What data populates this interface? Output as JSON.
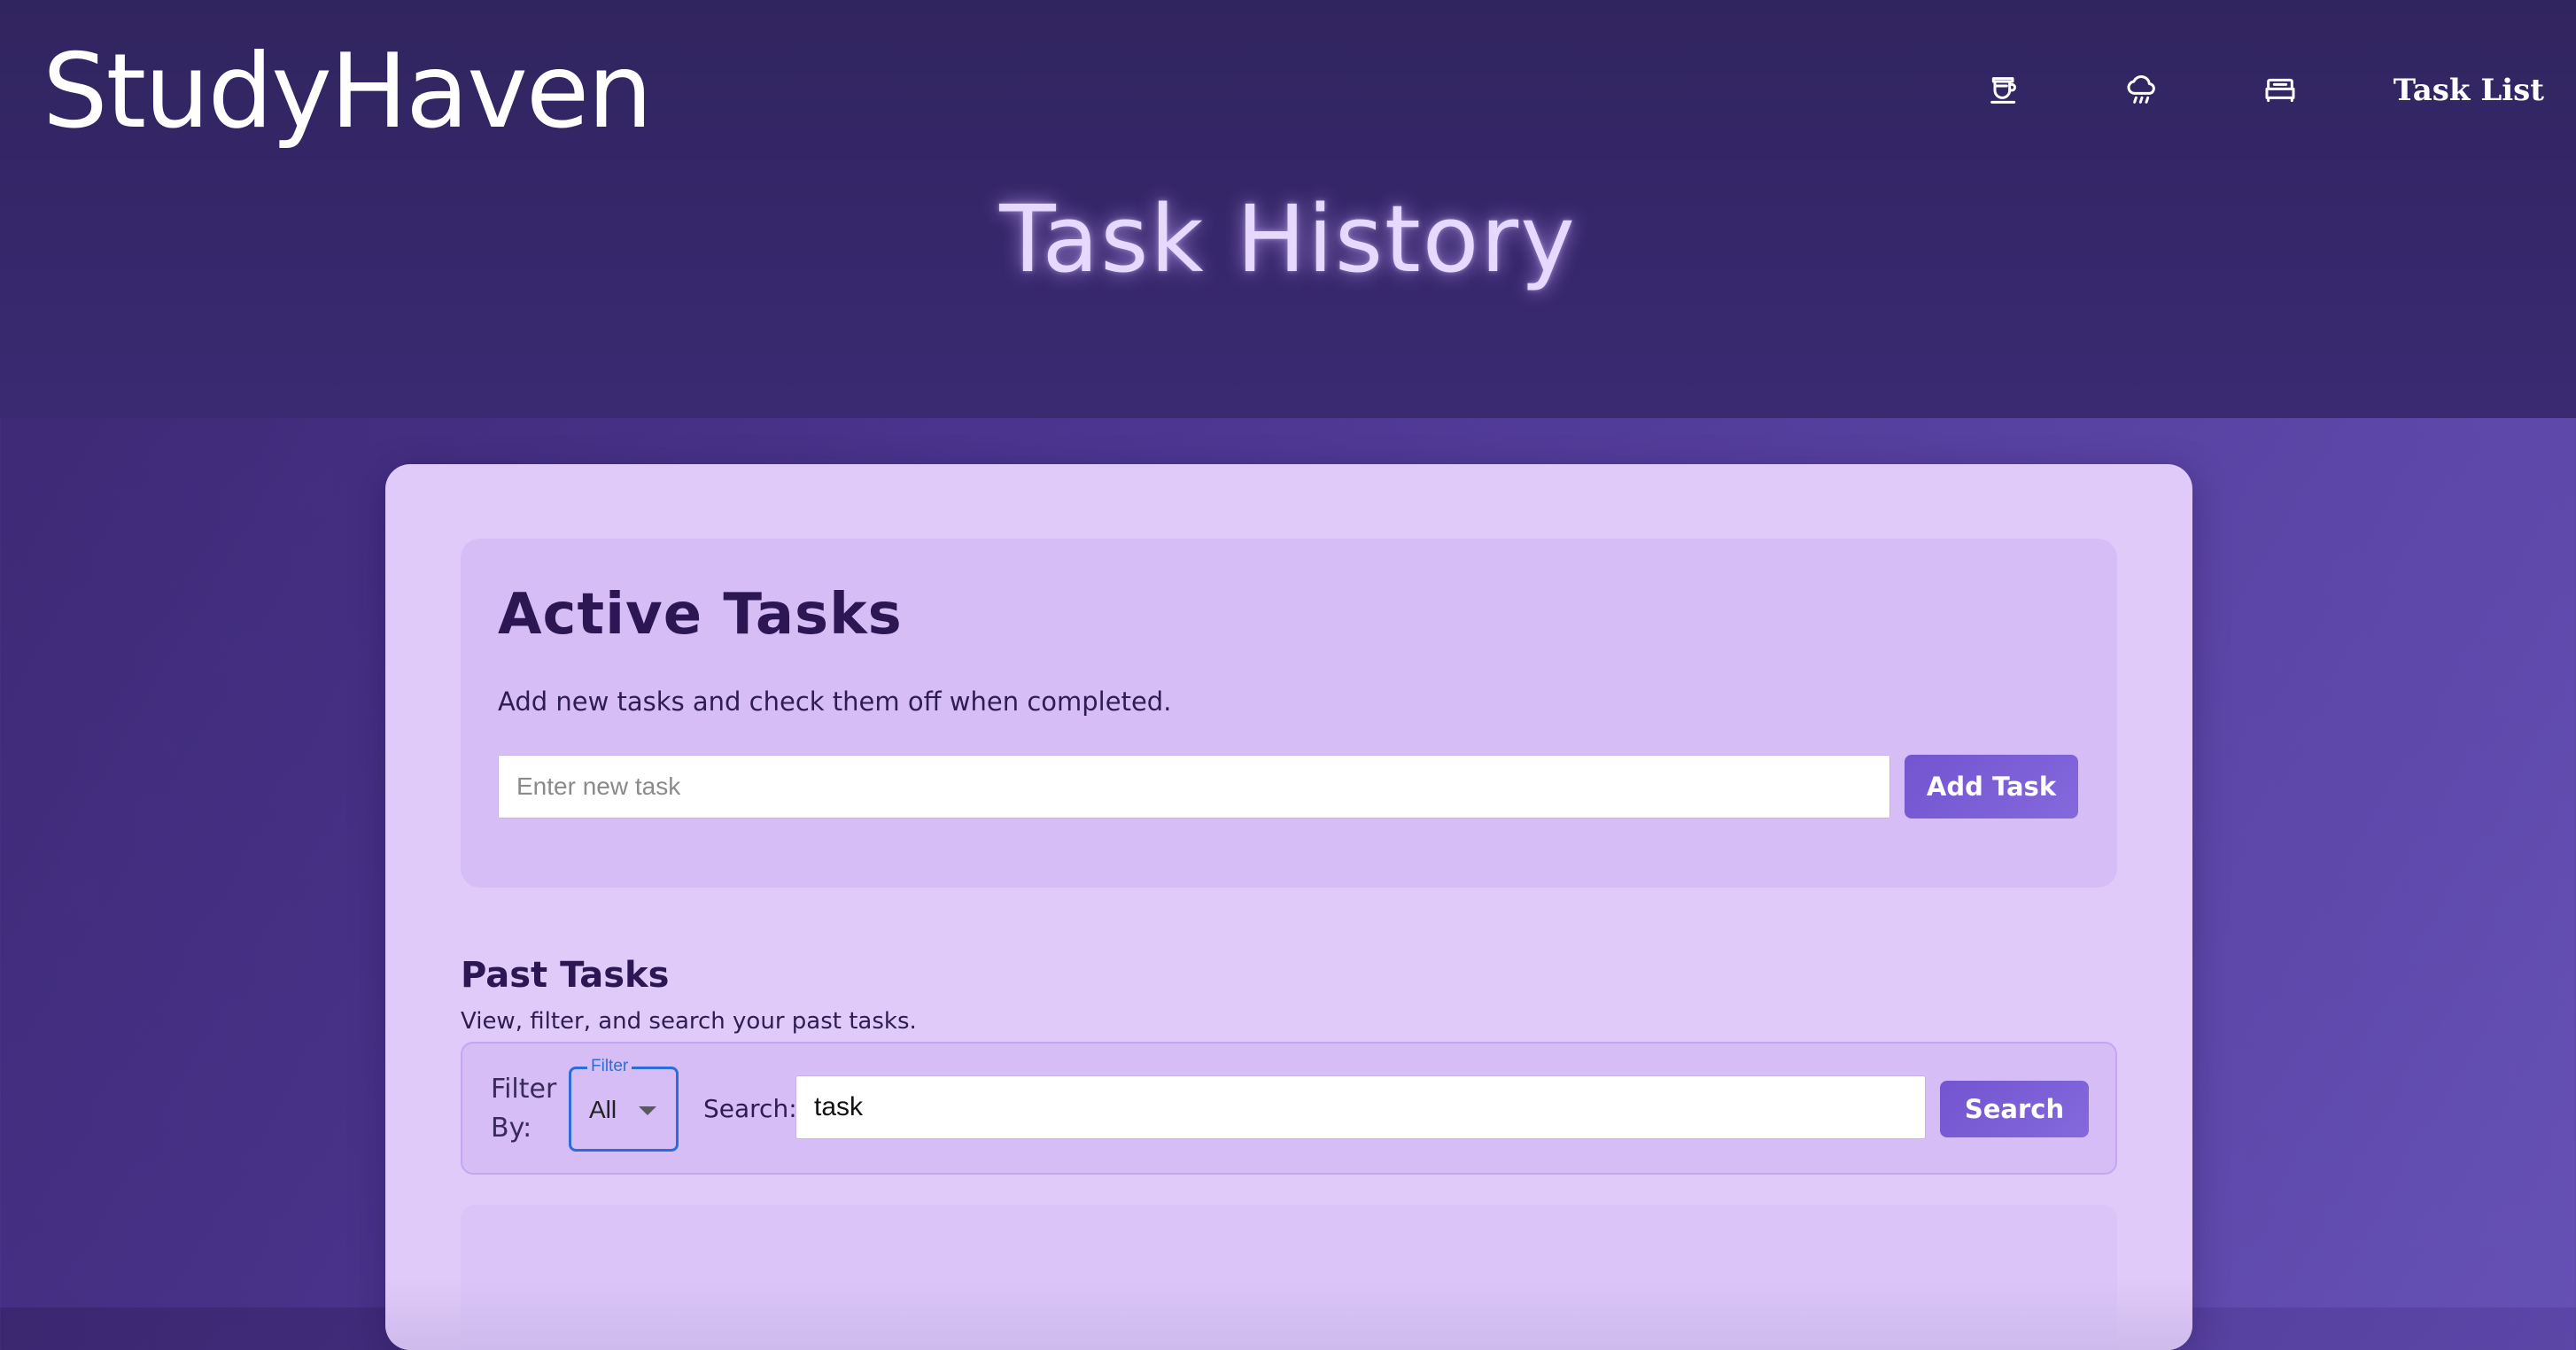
{
  "header": {
    "logo": "StudyHaven",
    "nav": {
      "icons": [
        {
          "name": "cup-icon"
        },
        {
          "name": "rain-cloud-icon"
        },
        {
          "name": "bed-icon"
        }
      ],
      "task_list_label": "Task List"
    },
    "page_title": "Task History"
  },
  "active_tasks": {
    "title": "Active Tasks",
    "description": "Add new tasks and check them off when completed.",
    "input_placeholder": "Enter new task",
    "add_button_label": "Add Task"
  },
  "past_tasks": {
    "title": "Past Tasks",
    "description": "View, filter, and search your past tasks.",
    "filter_by_label": "Filter By:",
    "filter_legend": "Filter",
    "filter_value": "All",
    "search_label": "Search:",
    "search_value": "task",
    "search_button_label": "Search"
  },
  "colors": {
    "accent": "#7355d0",
    "header_bg": "#31255f",
    "card_bg": "#dfcaf9",
    "title_glow": "#e6d9ff",
    "focus_blue": "#2b6fd6"
  }
}
